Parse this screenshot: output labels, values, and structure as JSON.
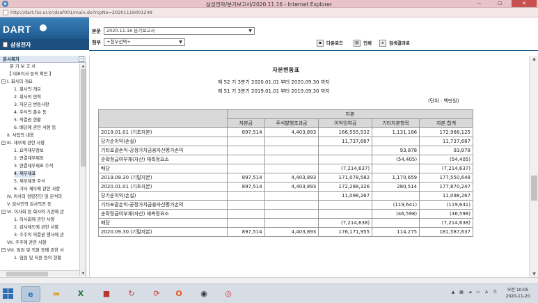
{
  "window": {
    "title": "삼성전자/분기보고서/2020.11.16 - Internet Explorer",
    "url": "http://dart.fss.or.kr/dsaf001/main.do?rcpNo=20201116001248",
    "min_label": "—",
    "max_label": "☐",
    "close_label": "✕"
  },
  "app": {
    "logo": "DART",
    "company": "삼성전자"
  },
  "doc_header": {
    "main_label": "본문",
    "main_value": "2020.11.16  분기보고서",
    "attach_label": "첨부",
    "attach_value": "+첨부선택+",
    "download_label": "다운로드",
    "print_label": "인쇄",
    "search_result_label": "검색결과로"
  },
  "sidebar": {
    "title": "문서목차",
    "collapse_label": "«",
    "items": [
      {
        "label": "분 기 보 고 서",
        "box": ""
      },
      {
        "label": "【 대표이사 등의 확인 】",
        "box": ""
      },
      {
        "label": "I. 회사의 개요",
        "box": "−"
      },
      {
        "label": "1. 회사의 개요",
        "box": ""
      },
      {
        "label": "2. 회사의 연혁",
        "box": ""
      },
      {
        "label": "3. 자본금 변동사항",
        "box": ""
      },
      {
        "label": "4. 주식의 총수 등",
        "box": ""
      },
      {
        "label": "5. 의결권 현황",
        "box": ""
      },
      {
        "label": "6. 배당에 관한 사항 등",
        "box": ""
      },
      {
        "label": "II. 사업의 내용",
        "box": ""
      },
      {
        "label": "III. 재무에 관한 사항",
        "box": "−"
      },
      {
        "label": "1. 요약재무정보",
        "box": ""
      },
      {
        "label": "2. 연결재무제표",
        "box": ""
      },
      {
        "label": "3. 연결재무제표 주석",
        "box": ""
      },
      {
        "label": "4. 재무제표",
        "box": ""
      },
      {
        "label": "5. 재무제표 주석",
        "box": ""
      },
      {
        "label": "6. 기타 재무에 관한 사항",
        "box": ""
      },
      {
        "label": "IV. 이사의 경영진단 및 분석의",
        "box": ""
      },
      {
        "label": "V. 감사인의 감사의견 등",
        "box": ""
      },
      {
        "label": "VI. 이사회 등 회사의 기관에 관",
        "box": "−"
      },
      {
        "label": "1. 이사회에 관한 사항",
        "box": ""
      },
      {
        "label": "2. 감사제도에 관한 사항",
        "box": ""
      },
      {
        "label": "3. 주주의 의결권 행사에 관",
        "box": ""
      },
      {
        "label": "VII. 주주에 관한 사항",
        "box": ""
      },
      {
        "label": "VIII. 임원 및 직원 등에 관한 사",
        "box": "−"
      },
      {
        "label": "1. 임원 및 직원 등의 현황",
        "box": ""
      }
    ]
  },
  "statement": {
    "title": "자본변동표",
    "period_current": "제 52 기 3분기 2020.01.01 부터 2020.09.30 까지",
    "period_prior": "제 51 기 3분기 2019.01.01 부터 2019.09.30 까지",
    "unit": "(단위 : 백만원)",
    "group_header": "자본",
    "columns": [
      "자본금",
      "주식발행초과금",
      "이익잉여금",
      "기타자본항목",
      "자본 합계"
    ],
    "rows": [
      {
        "label": "2019.01.01 (기초자본)",
        "values": [
          "897,514",
          "4,403,893",
          "166,555,532",
          "1,131,186",
          "172,988,125"
        ]
      },
      {
        "label": "당기순이익(손실)",
        "values": [
          "",
          "",
          "11,737,687",
          "",
          "11,737,687"
        ]
      },
      {
        "label": "기타포괄손익-공정가치금융자산평가손익",
        "values": [
          "",
          "",
          "",
          "93,878",
          "93,878"
        ]
      },
      {
        "label": "순확정급여부채(자산) 재측정요소",
        "values": [
          "",
          "",
          "",
          "(54,405)",
          "(54,405)"
        ]
      },
      {
        "label": "배당",
        "values": [
          "",
          "",
          "(7,214,637)",
          "",
          "(7,214,637)"
        ]
      },
      {
        "label": "2019.09.30 (기말자본)",
        "values": [
          "897,514",
          "4,403,893",
          "171,078,582",
          "1,170,659",
          "177,550,648"
        ]
      },
      {
        "label": "2020.01.01 (기초자본)",
        "values": [
          "897,514",
          "4,403,893",
          "172,288,326",
          "280,514",
          "177,870,247"
        ]
      },
      {
        "label": "당기순이익(손실)",
        "values": [
          "",
          "",
          "11,098,267",
          "",
          "11,098,267"
        ]
      },
      {
        "label": "기타포괄손익-공정가치금융자산평가손익",
        "values": [
          "",
          "",
          "",
          "(119,641)",
          "(119,641)"
        ]
      },
      {
        "label": "순확정급여부채(자산) 재측정요소",
        "values": [
          "",
          "",
          "",
          "(46,598)",
          "(46,598)"
        ]
      },
      {
        "label": "배당",
        "values": [
          "",
          "",
          "(7,214,638)",
          "",
          "(7,214,638)"
        ]
      },
      {
        "label": "2020.09.30 (기말자본)",
        "values": [
          "897,514",
          "4,403,893",
          "176,171,955",
          "114,275",
          "181,587,637"
        ]
      }
    ]
  },
  "taskbar": {
    "icons": [
      "ie-icon",
      "file-explorer-icon",
      "excel-icon",
      "app-icon",
      "sync-icon",
      "refresh-icon",
      "office-icon",
      "camera-icon",
      "chrome-icon"
    ],
    "time": "오전 10:05",
    "date": "2020-11-20"
  }
}
